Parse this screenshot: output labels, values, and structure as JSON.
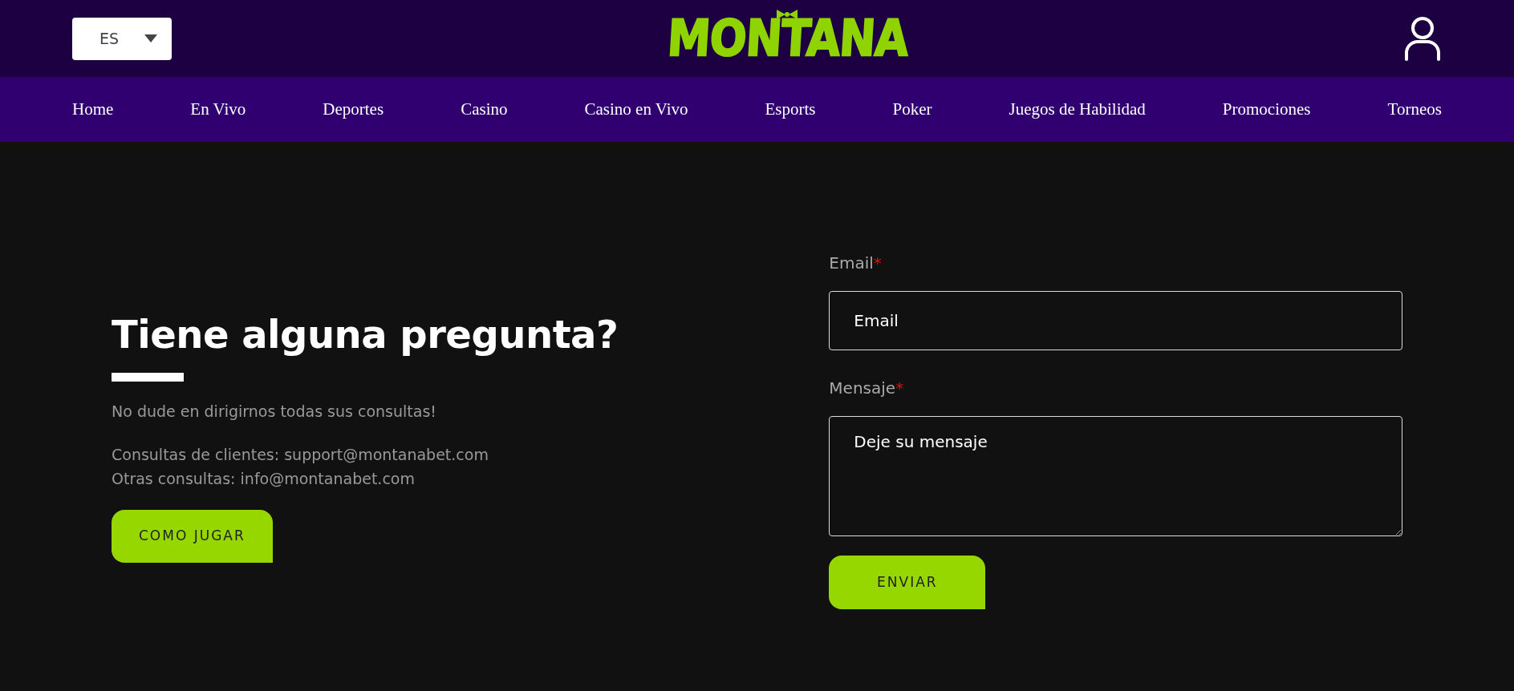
{
  "header": {
    "language": "ES",
    "logo": "MONTANA"
  },
  "nav": [
    {
      "label": "Home"
    },
    {
      "label": "En Vivo"
    },
    {
      "label": "Deportes"
    },
    {
      "label": "Casino"
    },
    {
      "label": "Casino en Vivo"
    },
    {
      "label": "Esports"
    },
    {
      "label": "Poker"
    },
    {
      "label": "Juegos de Habilidad"
    },
    {
      "label": "Promociones"
    },
    {
      "label": "Torneos"
    }
  ],
  "contact": {
    "title": "Tiene alguna pregunta?",
    "subtitle": "No dude en dirigirnos todas sus consultas!",
    "lines": [
      "Consultas de clientes: support@montanabet.com",
      "Otras consultas: info@montanabet.com"
    ],
    "button": "COMO JUGAR"
  },
  "form": {
    "fields": [
      {
        "kind": "input",
        "label": "Email",
        "required_mark": "*",
        "placeholder": "Email"
      },
      {
        "kind": "textarea",
        "label": "Mensaje",
        "required_mark": "*",
        "placeholder": "Deje su mensaje"
      }
    ],
    "submit": "ENVIAR"
  }
}
